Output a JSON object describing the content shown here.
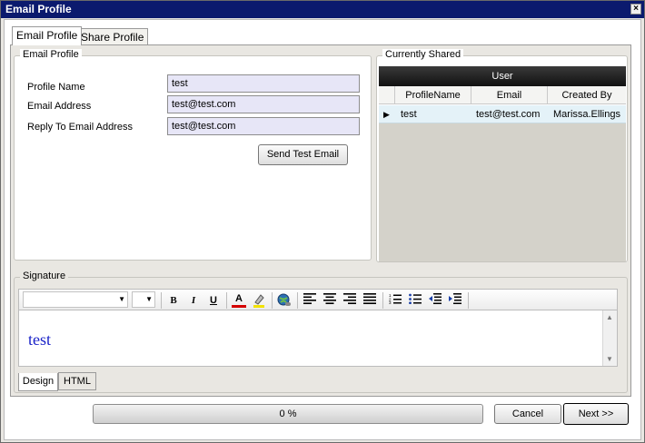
{
  "window": {
    "title": "Email Profile",
    "close_glyph": "×"
  },
  "tabs": [
    {
      "label": "Email Profile"
    },
    {
      "label": "Share Profile"
    }
  ],
  "email_profile": {
    "legend": "Email Profile",
    "fields": [
      {
        "label": "Profile Name",
        "value": "test"
      },
      {
        "label": "Email Address",
        "value": "test@test.com"
      },
      {
        "label": "Reply To Email Address",
        "value": "test@test.com"
      }
    ],
    "send_test_label": "Send Test Email"
  },
  "currently_shared": {
    "legend": "Currently Shared",
    "group_header": "User",
    "columns": [
      "ProfileName",
      "Email",
      "Created By"
    ],
    "rows": [
      {
        "profile_name": "test",
        "email": "test@test.com",
        "created_by": "Marissa.Ellings"
      }
    ],
    "row_indicator": "▶"
  },
  "signature": {
    "legend": "Signature",
    "toolbar": {
      "bold": "B",
      "italic": "I",
      "underline": "U",
      "font_color": "A"
    },
    "content": "test",
    "modes": [
      "Design",
      "HTML"
    ]
  },
  "footer": {
    "progress_label": "0 %",
    "progress": 0,
    "cancel_label": "Cancel",
    "next_label": "Next >>"
  },
  "colors": {
    "titlebar": "#0b1a6e",
    "input_bg": "#e7e6f7",
    "selected_row": "#e4f2f8",
    "signature_text": "#1a22c8"
  }
}
